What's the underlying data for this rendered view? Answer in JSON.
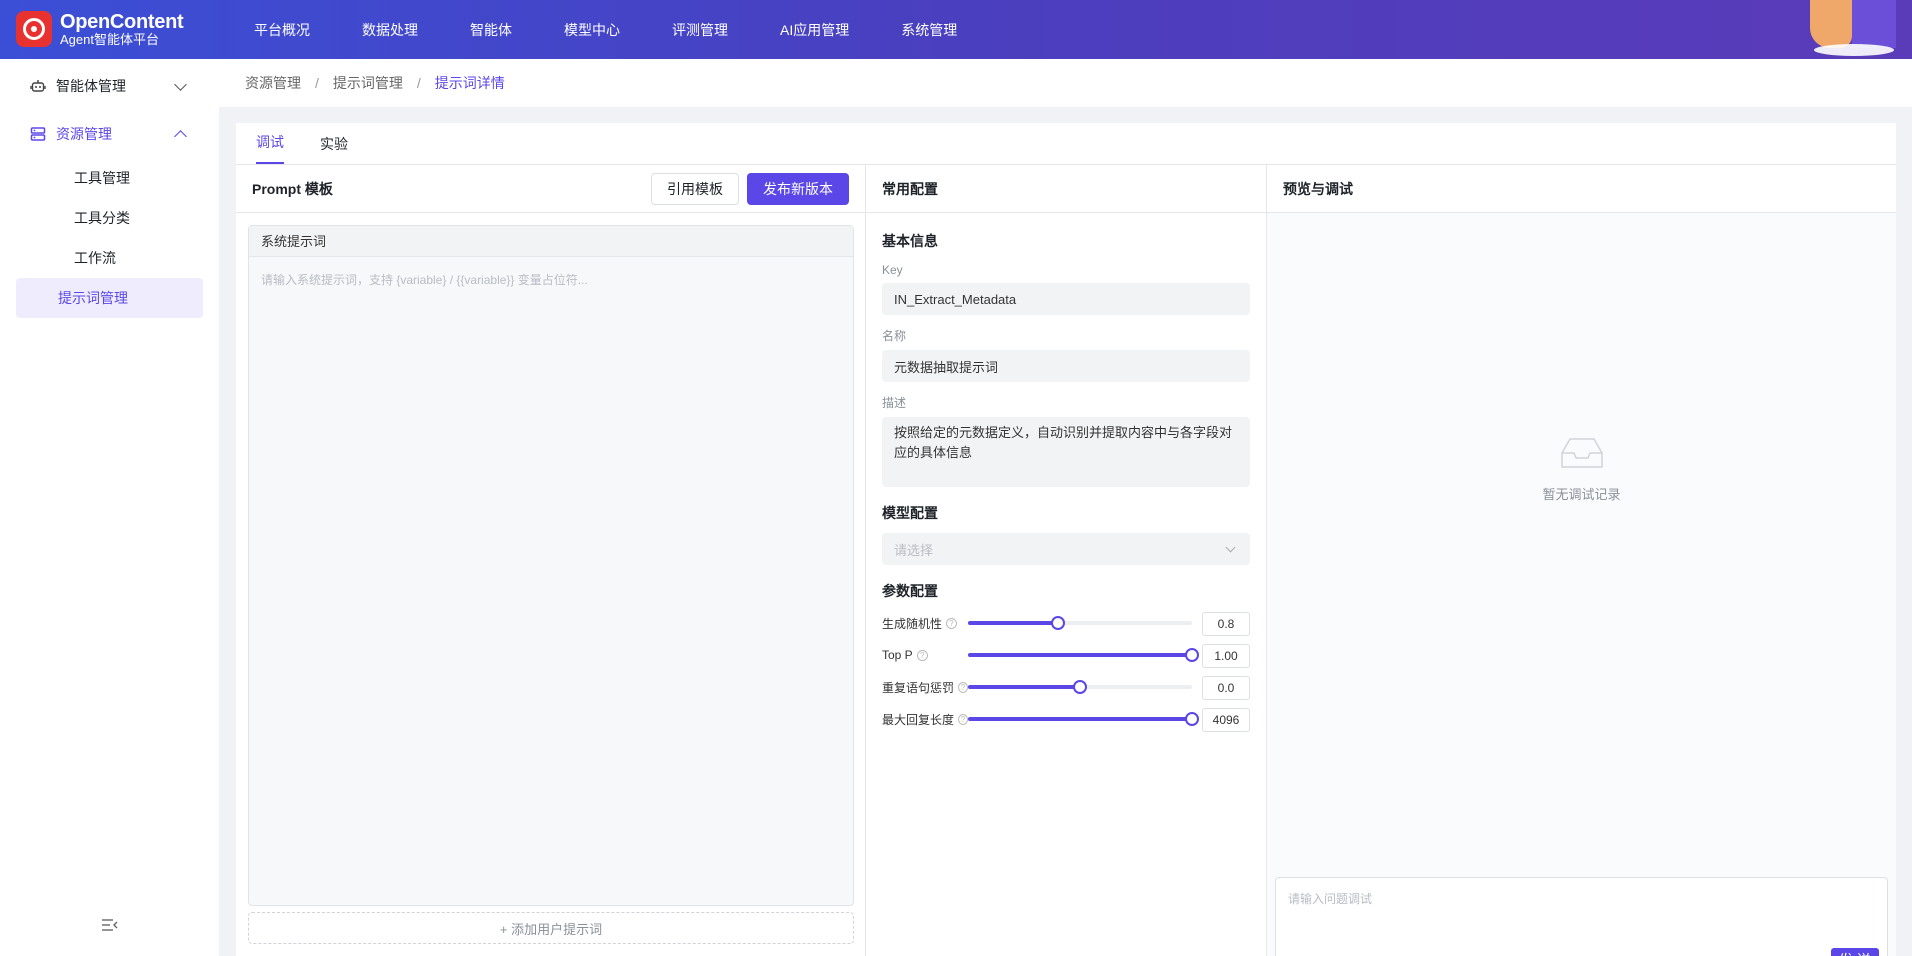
{
  "brand": {
    "name": "OpenContent",
    "subtitle": "Agent智能体平台"
  },
  "nav": [
    "平台概况",
    "数据处理",
    "智能体",
    "模型中心",
    "评测管理",
    "AI应用管理",
    "系统管理"
  ],
  "sidebar": {
    "group1": "智能体管理",
    "group2": "资源管理",
    "subs": [
      "工具管理",
      "工具分类",
      "工作流",
      "提示词管理"
    ]
  },
  "breadcrumb": [
    "资源管理",
    "提示词管理",
    "提示词详情"
  ],
  "tabs": [
    "调试",
    "实验"
  ],
  "prompt": {
    "title": "Prompt 模板",
    "ref_button": "引用模板",
    "publish_button": "发布新版本",
    "system_title": "系统提示词",
    "system_placeholder": "请输入系统提示词，支持 {variable} / {{variable}} 变量占位符...",
    "add_user": "+ 添加用户提示词"
  },
  "config": {
    "title": "常用配置",
    "basic_title": "基本信息",
    "key_label": "Key",
    "key_value": "IN_Extract_Metadata",
    "name_label": "名称",
    "name_value": "元数据抽取提示词",
    "desc_label": "描述",
    "desc_value": "按照给定的元数据定义，自动识别并提取内容中与各字段对应的具体信息",
    "model_title": "模型配置",
    "model_placeholder": "请选择",
    "param_title": "参数配置",
    "params": [
      {
        "label": "生成随机性",
        "value": "0.8",
        "fraction": 0.4
      },
      {
        "label": "Top P",
        "value": "1.00",
        "fraction": 1.0
      },
      {
        "label": "重复语句惩罚",
        "value": "0.0",
        "fraction": 0.5
      },
      {
        "label": "最大回复长度",
        "value": "4096",
        "fraction": 1.0
      }
    ]
  },
  "preview": {
    "title": "预览与调试",
    "empty": "暂无调试记录",
    "input_placeholder": "请输入问题调试",
    "send": "发 送"
  },
  "colors": {
    "accent": "#5b47e8",
    "logo": "#e8322f"
  }
}
